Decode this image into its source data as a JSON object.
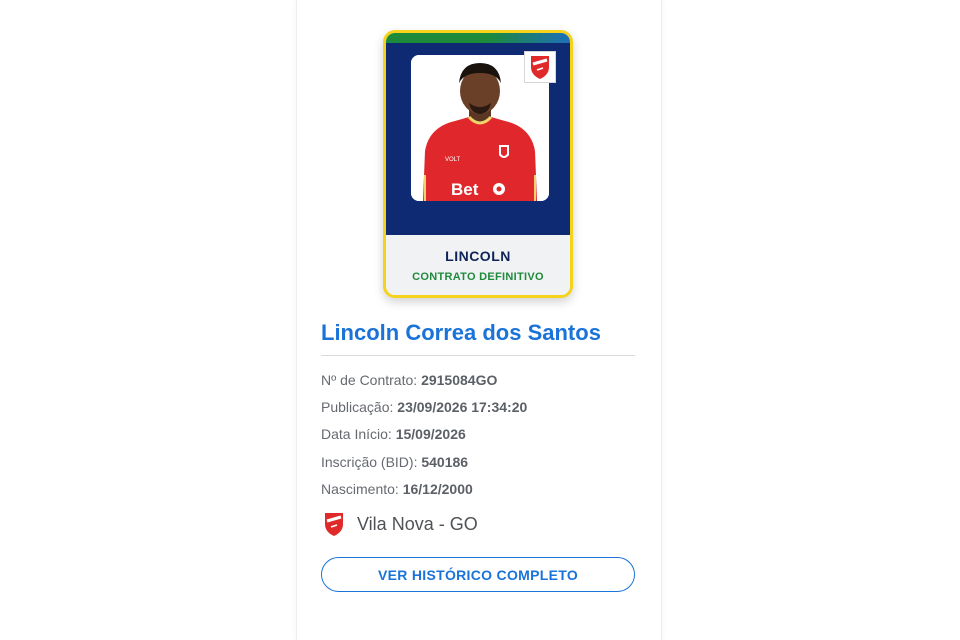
{
  "player_card": {
    "nickname": "LINCOLN",
    "contract_type": "CONTRATO DEFINITIVO",
    "jersey_sponsor": "Bet",
    "jersey_maker": "VOLT"
  },
  "player": {
    "full_name": "Lincoln Correa dos Santos"
  },
  "details": [
    {
      "label": "Nº de Contrato:",
      "value": "2915084GO"
    },
    {
      "label": "Publicação:",
      "value": "23/09/2026 17:34:20"
    },
    {
      "label": "Data Início:",
      "value": "15/09/2026"
    },
    {
      "label": "Inscrição (BID):",
      "value": "540186"
    },
    {
      "label": "Nascimento:",
      "value": "16/12/2000"
    }
  ],
  "club": {
    "name": "Vila Nova - GO",
    "icon": "club-crest-icon"
  },
  "actions": {
    "history_button": "VER HISTÓRICO COMPLETO"
  },
  "colors": {
    "card_border": "#f5d21c",
    "card_navy": "#0d2a73",
    "contract_green": "#1f8a3c",
    "link_blue": "#1a73d9",
    "club_red": "#e02a2a"
  }
}
